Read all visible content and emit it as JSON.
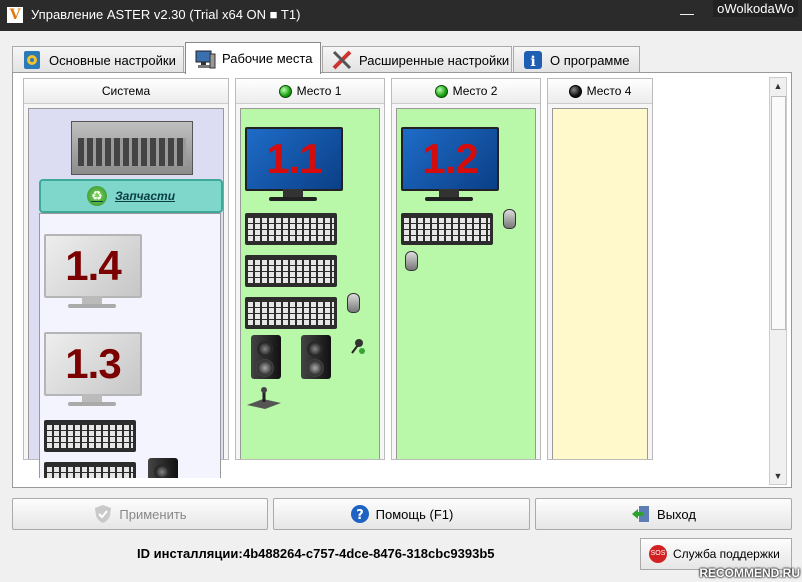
{
  "window": {
    "title": "Управление ASTER v2.30 (Trial x64 ON ■ T1)",
    "logo_letter": "V",
    "minimize_glyph": "—",
    "watermark": "oWolkodaWo"
  },
  "tabs": [
    {
      "label": "Основные настройки",
      "icon": "settings-book-icon",
      "active": false
    },
    {
      "label": "Рабочие места",
      "icon": "workstation-icon",
      "active": true
    },
    {
      "label": "Расширенные настройки",
      "icon": "tools-icon",
      "active": false
    },
    {
      "label": "О программе",
      "icon": "info-icon",
      "active": false
    }
  ],
  "columns": {
    "system": {
      "title": "Система",
      "parts_label": "Запчасти",
      "monitors": [
        "1.4",
        "1.3"
      ]
    },
    "place1": {
      "title": "Место 1",
      "status": "green",
      "monitor": "1.1"
    },
    "place2": {
      "title": "Место 2",
      "status": "green",
      "monitor": "1.2"
    },
    "place4": {
      "title": "Место 4",
      "status": "black"
    }
  },
  "buttons": {
    "apply": "Применить",
    "help": "Помощь (F1)",
    "exit": "Выход",
    "support": "Служба поддержки"
  },
  "install": {
    "label": "ID инсталляции:",
    "id": "4b488264-c757-4dce-8476-318cbc9393b5"
  },
  "watermark_bottom": "RECOMMEND.RU",
  "colors": {
    "workplace_green": "#b9f8a9",
    "workplace_empty": "#fff9cc",
    "parts_button": "#7fd7cb",
    "monitor_number": "#d60b0b"
  }
}
